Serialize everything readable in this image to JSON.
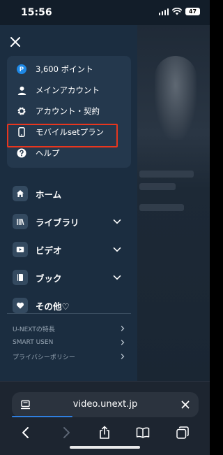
{
  "status_bar": {
    "time": "15:56",
    "battery": "47"
  },
  "drawer": {
    "account_card": {
      "items": [
        {
          "label": "3,600 ポイント",
          "icon": "points-icon",
          "badge": "P"
        },
        {
          "label": "メインアカウント",
          "icon": "person-icon"
        },
        {
          "label": "アカウント・契約",
          "icon": "gear-icon"
        },
        {
          "label": "モバイルsetプラン",
          "icon": "phone-icon"
        },
        {
          "label": "ヘルプ",
          "icon": "help-icon"
        }
      ]
    },
    "nav": [
      {
        "label": "ホーム",
        "icon": "home-icon",
        "expandable": false
      },
      {
        "label": "ライブラリ",
        "icon": "library-icon",
        "expandable": true
      },
      {
        "label": "ビデオ",
        "icon": "video-icon",
        "expandable": true
      },
      {
        "label": "ブック",
        "icon": "book-icon",
        "expandable": true
      },
      {
        "label": "その他♡",
        "icon": "heart-icon",
        "expandable": false
      }
    ],
    "links": [
      {
        "label": "U-NEXTの特長"
      },
      {
        "label": "SMART USEN"
      },
      {
        "label": "プライバシーポリシー"
      }
    ]
  },
  "browser": {
    "url": "video.unext.jp"
  },
  "colors": {
    "drawer_bg": "#1b2d40",
    "card_bg": "#24384d",
    "highlight": "#e8361e",
    "accent_blue": "#2f7fe0",
    "points_badge": "#1e88e5"
  }
}
